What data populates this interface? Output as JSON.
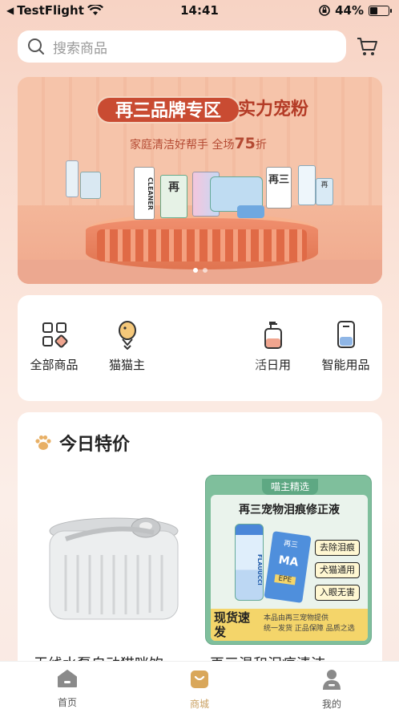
{
  "status_bar": {
    "back_app": "TestFlight",
    "time": "14:41",
    "battery": "44%",
    "battery_level": 0.44
  },
  "search": {
    "placeholder": "搜索商品"
  },
  "banner": {
    "headline": "再三品牌专区",
    "headline2": "实力宠粉",
    "subline_prefix": "家庭清洁好帮手  全场",
    "subline_number": "75",
    "subline_suffix": "折",
    "product_labels": [
      "CLEANER",
      "再",
      "再三",
      "再"
    ],
    "page_count": 2,
    "active_page": 0
  },
  "categories": [
    {
      "label": "全部商品",
      "icon": "grid-icon"
    },
    {
      "label": "猫猫主",
      "icon": "fish-icon"
    },
    {
      "label": "",
      "icon": "cat-bowl-icon"
    },
    {
      "label": "活日用",
      "icon": "soap-bottle-icon"
    },
    {
      "label": "智能用品",
      "icon": "smart-device-icon"
    }
  ],
  "deals": {
    "title": "今日特价",
    "item1_title": "无线水泵自动猫咪饮",
    "item2_title": "再三温和泪痕清洁",
    "card": {
      "tag": "喵主精选",
      "headline": "再三宠物泪痕修正液",
      "bottle_label": "FLAUUCCI",
      "pack_labels": [
        "再三",
        "MA",
        "EPE"
      ],
      "chips": [
        "去除泪痕",
        "犬猫通用",
        "入眼无害"
      ],
      "badge": "现货速发",
      "note": [
        "本品由再三宠物提供",
        "统一发货 正品保障 品质之选"
      ]
    }
  },
  "tabbar": [
    {
      "label": "首页",
      "icon": "home-icon"
    },
    {
      "label": "商城",
      "icon": "shop-bag-icon",
      "active": true
    },
    {
      "label": "我的",
      "icon": "profile-icon"
    }
  ],
  "colors": {
    "accent": "#caa061",
    "banner_red": "#c94b32",
    "card_green": "#7fbf9c",
    "badge_yellow": "#f4d56a"
  }
}
